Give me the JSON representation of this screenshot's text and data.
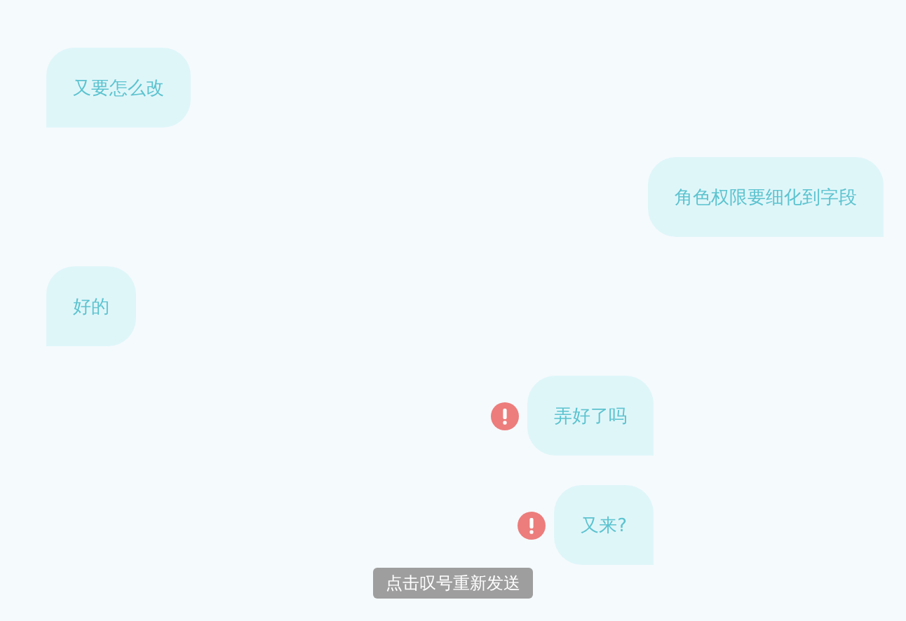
{
  "messages": [
    {
      "text": "又要怎么改",
      "kind": "received",
      "failed": false
    },
    {
      "text": "角色权限要细化到字段",
      "kind": "sent",
      "failed": false
    },
    {
      "text": "好的",
      "kind": "received",
      "failed": false
    },
    {
      "text": "弄好了吗",
      "kind": "sent",
      "failed": true
    },
    {
      "text": "又来?",
      "kind": "sent",
      "failed": true
    }
  ],
  "toast": "点击叹号重新发送"
}
